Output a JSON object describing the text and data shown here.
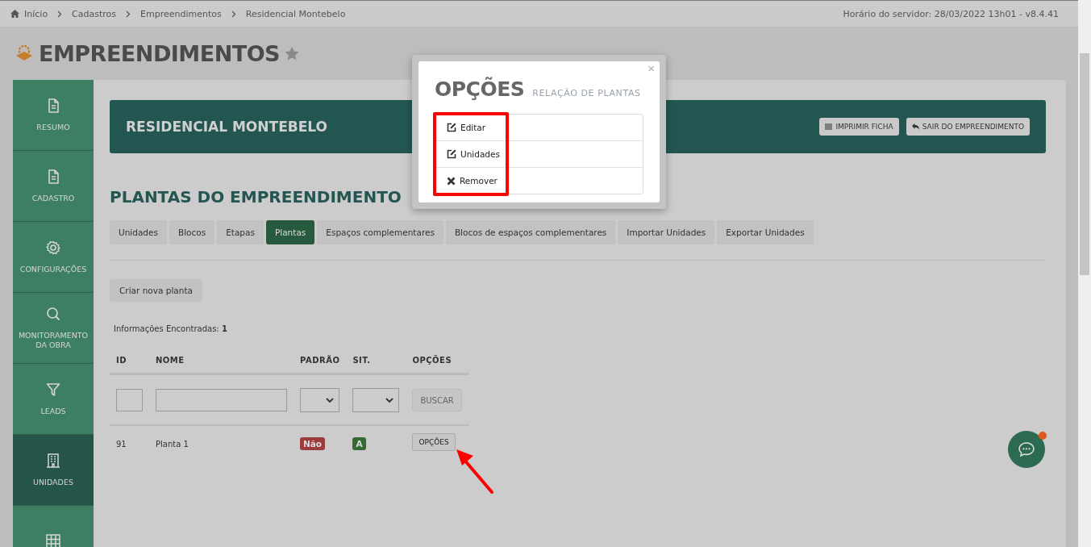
{
  "breadcrumb": [
    {
      "label": "Início"
    },
    {
      "label": "Cadastros"
    },
    {
      "label": "Empreendimentos"
    },
    {
      "label": "Residencial Montebelo"
    }
  ],
  "server_info": "Horário do servidor: 28/03/2022 13h01 - v8.4.41",
  "page_title": "EMPREENDIMENTOS",
  "sidebar": {
    "items": [
      {
        "label": "RESUMO",
        "selected": false
      },
      {
        "label": "CADASTRO",
        "selected": false
      },
      {
        "label": "CONFIGURAÇÕES",
        "selected": false
      },
      {
        "label": "MONITORAMENTO DA OBRA",
        "selected": false
      },
      {
        "label": "LEADS",
        "selected": false
      },
      {
        "label": "UNIDADES",
        "selected": true
      },
      {
        "selected": false
      }
    ]
  },
  "project": {
    "name": "RESIDENCIAL MONTEBELO",
    "buttons": [
      {
        "label": "IMPRIMIR FICHA"
      },
      {
        "label": "SAIR DO EMPREENDIMENTO"
      }
    ]
  },
  "section_title": "PLANTAS DO EMPREENDIMENTO",
  "tabs": [
    {
      "label": "Unidades",
      "selected": false
    },
    {
      "label": "Blocos",
      "selected": false
    },
    {
      "label": "Etapas",
      "selected": false
    },
    {
      "label": "Plantas",
      "selected": true
    },
    {
      "label": "Espaços complementares",
      "selected": false
    },
    {
      "label": "Blocos de espaços complementares",
      "selected": false
    },
    {
      "label": "Importar Unidades",
      "selected": false
    },
    {
      "label": "Exportar Unidades",
      "selected": false
    }
  ],
  "create_button": "Criar nova planta",
  "results": "Informações Encontradas: **1**",
  "table": {
    "columns": [
      "ID",
      "NOME",
      "PADRÃO",
      "SIT.",
      "OPÇÕES"
    ],
    "filter_button": "BUSCAR",
    "rows": [
      {
        "id": "91",
        "name": "Planta 1",
        "padrao": {
          "label": "Não",
          "color": "#9c3b3b"
        },
        "sit": {
          "label": "A",
          "color": "#356a35"
        },
        "options": "OPÇÕES"
      }
    ]
  },
  "modal": {
    "close": "×",
    "title": "OPÇÕES",
    "subtitle": "RELAÇÃO DE PLANTAS",
    "items": [
      {
        "label": "Editar",
        "kind": "edit"
      },
      {
        "label": "Unidades",
        "kind": "edit"
      },
      {
        "label": "Remover",
        "kind": "remove"
      }
    ]
  }
}
